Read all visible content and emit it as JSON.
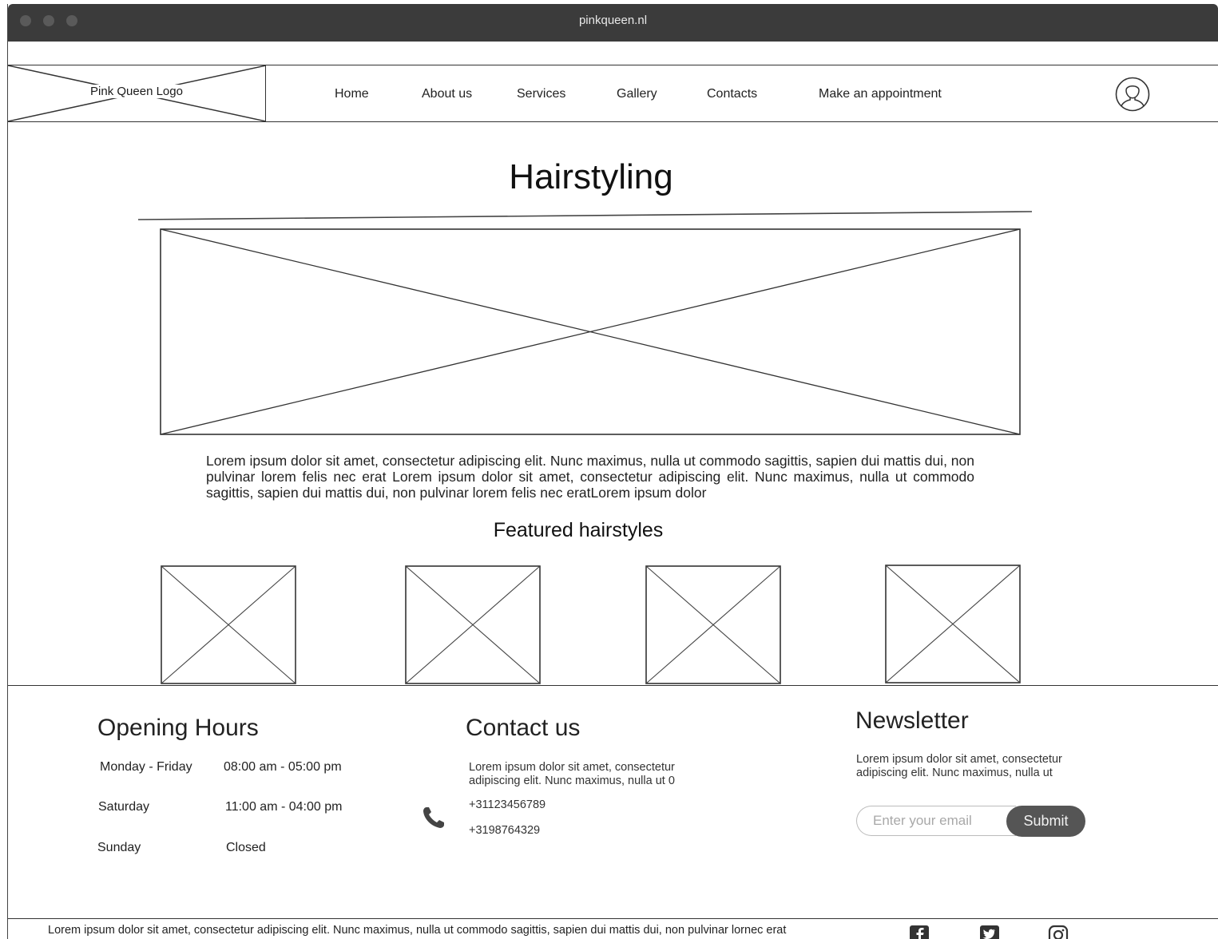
{
  "browser": {
    "url": "pinkqueen.nl"
  },
  "header": {
    "logo_label": "Pink Queen Logo",
    "nav": [
      {
        "label": "Home"
      },
      {
        "label": "About us"
      },
      {
        "label": "Services"
      },
      {
        "label": "Gallery"
      },
      {
        "label": "Contacts"
      },
      {
        "label": "Make an appointment"
      }
    ],
    "user_icon": "user-icon"
  },
  "main": {
    "title": "Hairstyling",
    "intro": "Lorem ipsum dolor sit amet, consectetur adipiscing elit. Nunc maximus, nulla ut commodo sagittis, sapien dui mattis dui, non pulvinar lorem felis nec erat Lorem ipsum dolor sit amet, consectetur adipiscing elit. Nunc maximus, nulla ut commodo sagittis, sapien dui mattis dui, non pulvinar lorem felis nec eratLorem ipsum dolor",
    "featured_title": "Featured hairstyles"
  },
  "footer": {
    "hours": {
      "title": "Opening Hours",
      "rows": [
        {
          "day": "Monday - Friday",
          "time": "08:00 am  - 05:00 pm"
        },
        {
          "day": "Saturday",
          "time": "11:00 am  - 04:00 pm"
        },
        {
          "day": "Sunday",
          "time": "Closed"
        }
      ]
    },
    "contact": {
      "title": "Contact us",
      "text": "Lorem ipsum dolor sit amet, consectetur adipiscing elit. Nunc maximus, nulla ut 0",
      "phones": [
        "+31123456789",
        "+3198764329"
      ],
      "icon": "phone-icon"
    },
    "newsletter": {
      "title": "Newsletter",
      "text": "Lorem ipsum dolor sit amet, consectetur adipiscing elit. Nunc maximus, nulla ut",
      "email_placeholder": "Enter your email",
      "submit_label": "Submit"
    }
  },
  "bottom": {
    "text": "Lorem ipsum dolor sit amet, consectetur adipiscing elit. Nunc maximus, nulla ut commodo sagittis, sapien dui mattis dui, non pulvinar lornec erat",
    "social_icons": [
      "facebook-icon",
      "twitter-icon",
      "instagram-icon"
    ]
  }
}
